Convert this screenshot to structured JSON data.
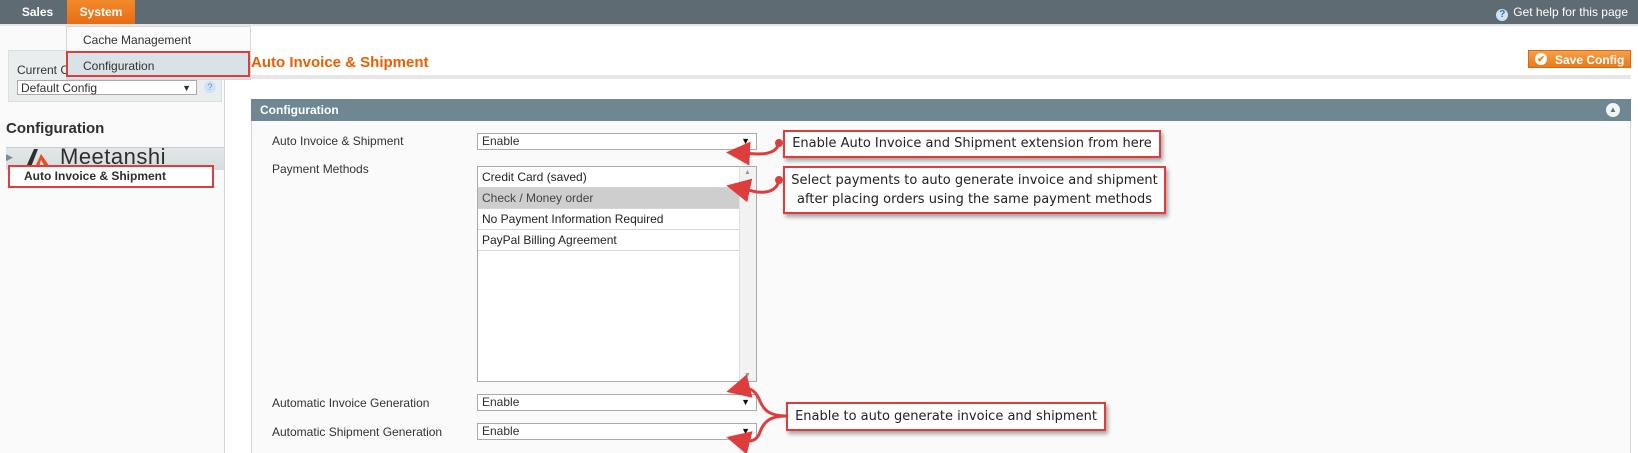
{
  "topnav": {
    "sales": "Sales",
    "system": "System",
    "help": "Get help for this page"
  },
  "dropdown": {
    "cache_management": "Cache Management",
    "configuration": "Configuration"
  },
  "left": {
    "scope_label": "Current C",
    "scope_value": "Default Config",
    "heading": "Configuration",
    "brand": "Meetanshi",
    "item": "Auto Invoice & Shipment"
  },
  "main": {
    "title": "Auto Invoice & Shipment",
    "save_button": "Save Config",
    "section_title": "Configuration",
    "fields": {
      "auto_invoice_label": "Auto Invoice & Shipment",
      "auto_invoice_value": "Enable",
      "payment_label": "Payment Methods",
      "payment_options": [
        "Credit Card (saved)",
        "Check / Money order",
        "No Payment Information Required",
        "PayPal Billing Agreement"
      ],
      "payment_selected": "Check / Money order",
      "invoice_gen_label": "Automatic Invoice Generation",
      "invoice_gen_value": "Enable",
      "shipment_gen_label": "Automatic Shipment Generation",
      "shipment_gen_value": "Enable"
    }
  },
  "callouts": {
    "enable_extension": "Enable Auto Invoice and Shipment extension from here",
    "select_payments_line1": "Select payments to auto generate invoice and shipment",
    "select_payments_line2": "after placing orders using the same payment methods",
    "enable_generate": "Enable to auto generate invoice and shipment"
  },
  "colors": {
    "accent_orange": "#eb5e00",
    "annotation_red": "#de3d3d",
    "topbar": "#5e6b73",
    "section_header": "#6f8792"
  }
}
